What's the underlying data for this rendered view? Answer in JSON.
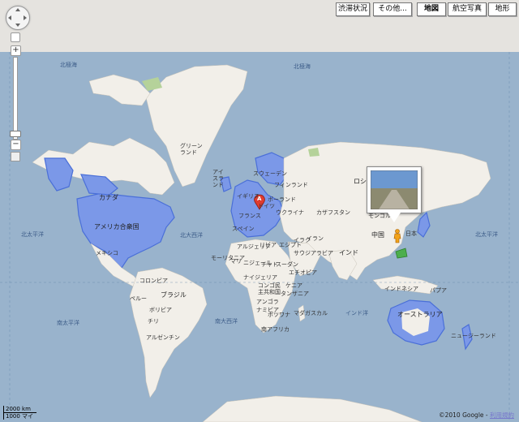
{
  "map_types": [
    "渋滞状況",
    "その他...",
    "地図",
    "航空写真",
    "地形"
  ],
  "active_map_type": "地図",
  "controls": {
    "zoom_in": "+",
    "zoom_out": "−"
  },
  "labels": {
    "oceans": {
      "arctic_left": "北極海",
      "arctic_right": "北極海",
      "n_atlantic": "北大西洋",
      "n_pacific_left": "北太平洋",
      "n_pacific_right": "北太平洋",
      "s_pacific": "南太平洋",
      "s_atlantic": "南大西洋",
      "indian": "インド洋"
    },
    "countries": {
      "greenland": "グリーンランド",
      "canada": "カナダ",
      "usa": "アメリカ合衆国",
      "mexico": "メキシコ",
      "colombia": "コロンビア",
      "peru": "ペルー",
      "brazil": "ブラジル",
      "bolivia": "ボリビア",
      "chile": "チリ",
      "argentina": "アルゼンチン",
      "iceland": "アイスランド",
      "sweden": "スウェーデン",
      "finland": "フィンランド",
      "uk": "イギリス",
      "france": "フランス",
      "germany": "ドイツ",
      "poland": "ポーランド",
      "ukraine": "ウクライナ",
      "spain": "スペイン",
      "russia": "ロシア",
      "kazakhstan": "カザフスタン",
      "mongolia": "モンゴル",
      "china": "中国",
      "japan": "日本",
      "india": "インド",
      "iran": "イラン",
      "iraq": "イラク",
      "saudi": "サウジアラビア",
      "algeria": "アルジェリア",
      "libya": "リビア",
      "egypt": "エジプト",
      "mali": "マリ",
      "niger": "ニジェール",
      "chad": "チャド",
      "sudan": "スーダン",
      "ethiopia": "エチオピア",
      "kenya": "ケニア",
      "tanzania": "タンザニア",
      "nigeria": "ナイジェリア",
      "drc": "コンゴ民主共和国",
      "angola": "アンゴラ",
      "namibia": "ナミビア",
      "botswana": "ボツワナ",
      "south_africa": "南アフリカ",
      "madagascar": "マダガスカル",
      "mauritania": "モーリタニア",
      "indonesia": "インドネシア",
      "australia": "オーストラリア",
      "nz": "ニュージーランド",
      "papua": "パプア"
    }
  },
  "scale": {
    "km": "2000 km",
    "mi": "1000 マイ"
  },
  "copyright": "©2010 Google -",
  "terms_link": "利用規約",
  "colors": {
    "ocean": "#99b3cc",
    "land": "#f2efe9",
    "highlight": "#7b98e8",
    "highlight_border": "#4a6fd8",
    "park": "#b5d29a",
    "green_region": "#4cae4c",
    "marker": "#e03b2f"
  },
  "marker_letter": "A"
}
